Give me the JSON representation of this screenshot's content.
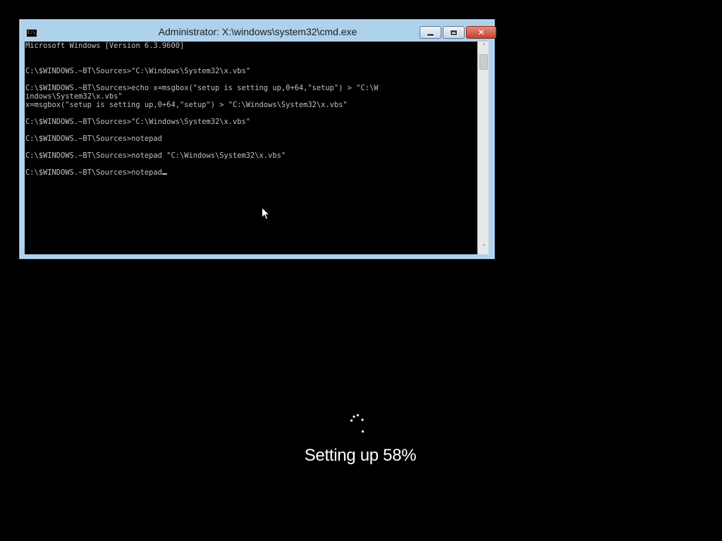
{
  "window": {
    "title": "Administrator: X:\\windows\\system32\\cmd.exe",
    "icon": "cmd-icon",
    "icon_text": "C:\\.",
    "buttons": {
      "minimize": "minimize-icon",
      "maximize": "maximize-icon",
      "close": "close-icon",
      "close_glyph": "✕"
    }
  },
  "console": {
    "lines": [
      "Microsoft Windows [Version 6.3.9600]",
      "",
      "",
      "C:\\$WINDOWS.~BT\\Sources>\"C:\\Windows\\System32\\x.vbs\"",
      "",
      "C:\\$WINDOWS.~BT\\Sources>echo x=msgbox(\"setup is setting up,0+64,\"setup\") > \"C:\\W",
      "indows\\System32\\x.vbs\"",
      "x=msgbox(\"setup is setting up,0+64,\"setup\") > \"C:\\Windows\\System32\\x.vbs\"",
      "",
      "C:\\$WINDOWS.~BT\\Sources>\"C:\\Windows\\System32\\x.vbs\"",
      "",
      "C:\\$WINDOWS.~BT\\Sources>notepad",
      "",
      "C:\\$WINDOWS.~BT\\Sources>notepad \"C:\\Windows\\System32\\x.vbs\"",
      "",
      "C:\\$WINDOWS.~BT\\Sources>notepad"
    ],
    "text_color": "#c0c0c0",
    "background": "#000000"
  },
  "scrollbar": {
    "up_arrow": "˄",
    "down_arrow": "˅"
  },
  "setup": {
    "status_text": "Setting up 58%",
    "progress_percent": 58,
    "spinner_icon": "loading-dots-icon"
  },
  "colors": {
    "window_frame": "#aed1ec",
    "close_button": "#c6402e",
    "desktop": "#000000"
  }
}
